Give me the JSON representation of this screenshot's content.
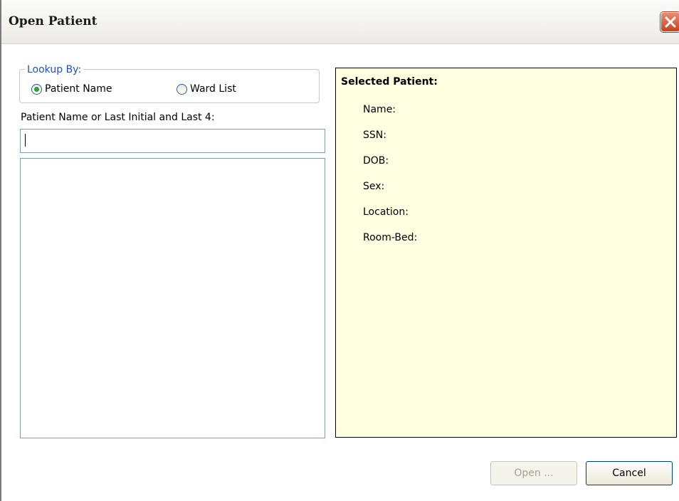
{
  "window": {
    "title": "Open Patient"
  },
  "lookup": {
    "legend": "Lookup By:",
    "options": [
      {
        "label": "Patient Name",
        "checked": true
      },
      {
        "label": "Ward List",
        "checked": false
      }
    ]
  },
  "search": {
    "label": "Patient Name or Last Initial and Last 4:",
    "value": ""
  },
  "selected_patient": {
    "title": "Selected Patient:",
    "fields": [
      "Name:",
      "SSN:",
      "DOB:",
      "Sex:",
      "Location:",
      "Room-Bed:"
    ]
  },
  "buttons": {
    "open_label": "Open ...",
    "open_enabled": false,
    "cancel_label": "Cancel"
  },
  "colors": {
    "panel_bg": "#ffffe1",
    "legend_text": "#1f4fd0",
    "radio_dot": "#2ea12e",
    "close_button": "#c9421c"
  },
  "icons": {
    "close": "close-icon"
  }
}
